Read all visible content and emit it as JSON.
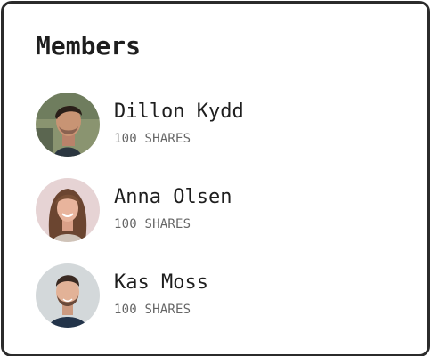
{
  "card": {
    "title": "Members"
  },
  "members": [
    {
      "name": "Dillon Kydd",
      "shares": "100 SHARES",
      "avatar_bg": "#6f7d5e",
      "skin": "#c89474",
      "hair": "#2a1f19"
    },
    {
      "name": "Anna Olsen",
      "shares": "100 SHARES",
      "avatar_bg": "#e6d3d4",
      "skin": "#e8b49c",
      "hair": "#6b4530"
    },
    {
      "name": "Kas Moss",
      "shares": "100 SHARES",
      "avatar_bg": "#d3d8da",
      "skin": "#e2b297",
      "hair": "#3a2a22"
    }
  ],
  "colors": {
    "border": "#2b2b2b",
    "title": "#1e1e1e",
    "subtext": "#666666"
  }
}
